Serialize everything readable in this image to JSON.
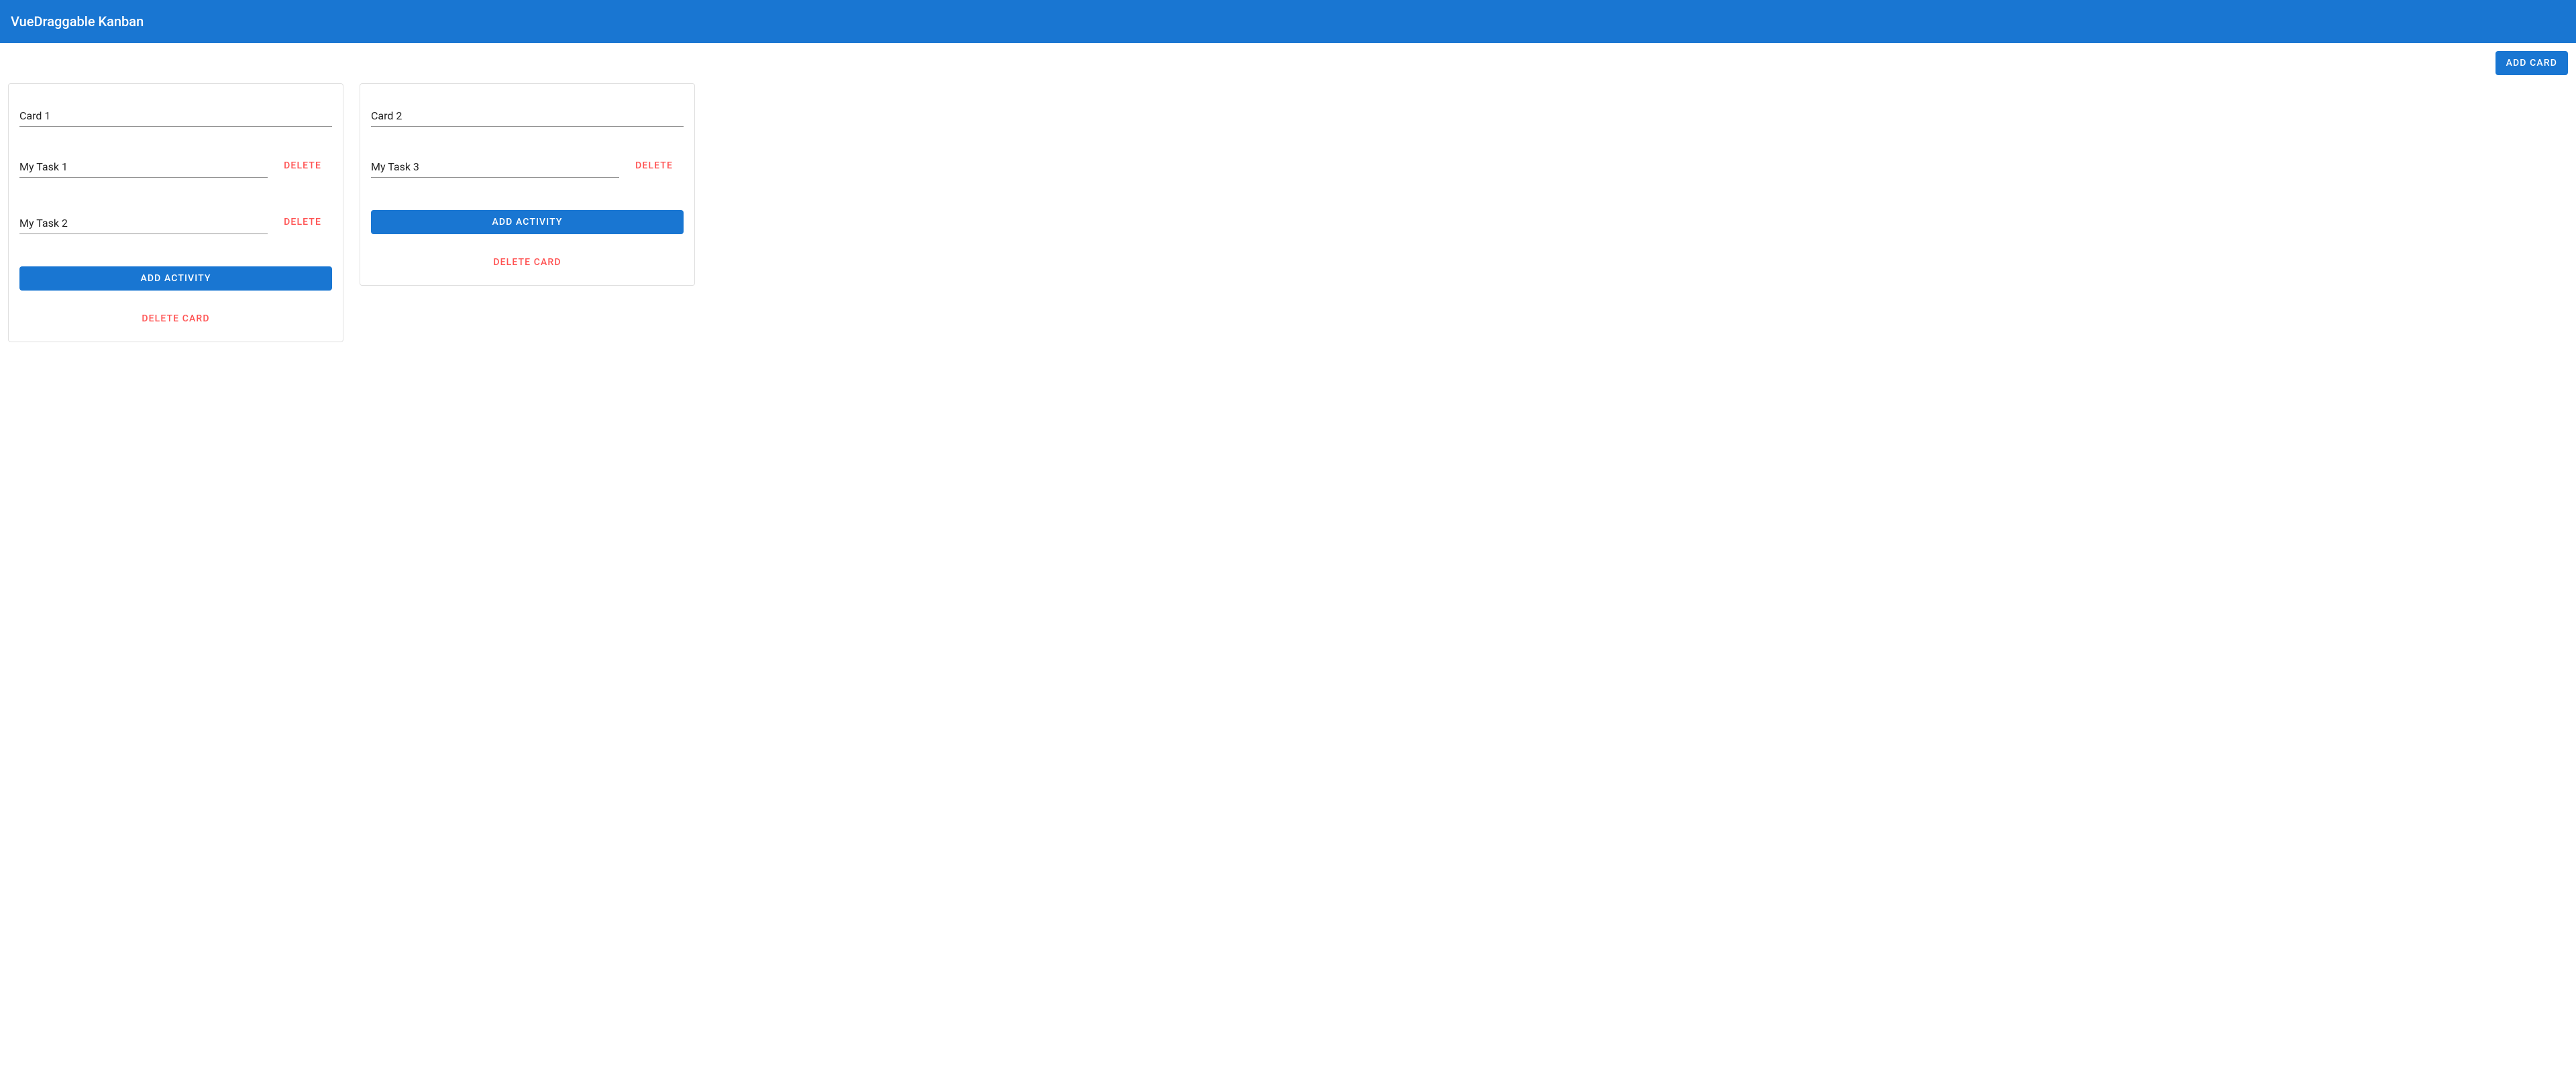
{
  "appbar": {
    "title": "VueDraggable Kanban"
  },
  "buttons": {
    "add_card": "Add Card",
    "add_activity": "Add Activity",
    "delete": "Delete",
    "delete_card": "Delete Card"
  },
  "colors": {
    "primary": "#1976d2",
    "error": "#ff5252"
  },
  "cards": [
    {
      "title": "Card 1",
      "activities": [
        {
          "name": "My Task 1"
        },
        {
          "name": "My Task 2"
        }
      ]
    },
    {
      "title": "Card 2",
      "activities": [
        {
          "name": "My Task 3"
        }
      ]
    }
  ]
}
